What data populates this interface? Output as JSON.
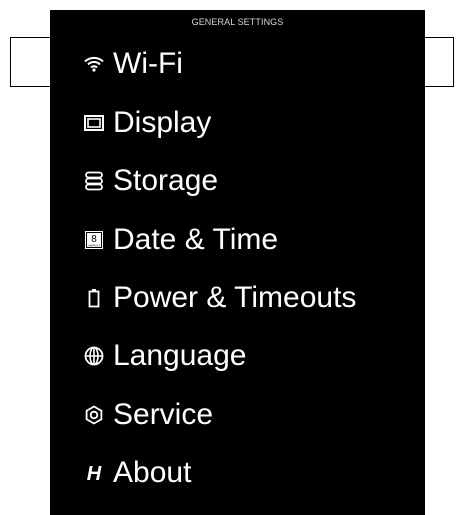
{
  "header": {
    "title": "GENERAL SETTINGS"
  },
  "menu": {
    "selected_index": 0,
    "items": [
      {
        "label": "Wi-Fi",
        "icon": "wifi-icon"
      },
      {
        "label": "Display",
        "icon": "display-icon"
      },
      {
        "label": "Storage",
        "icon": "storage-icon"
      },
      {
        "label": "Date & Time",
        "icon": "calendar-icon",
        "icon_text_big": "8",
        "icon_text_small": "MARCH"
      },
      {
        "label": "Power & Timeouts",
        "icon": "battery-icon"
      },
      {
        "label": "Language",
        "icon": "globe-icon"
      },
      {
        "label": "Service",
        "icon": "service-icon"
      },
      {
        "label": "About",
        "icon": "brand-logo-icon",
        "icon_text": "H"
      }
    ]
  },
  "colors": {
    "panel_background": "#000000",
    "text": "#ffffff",
    "header_text": "#d8d8d8",
    "selection_border": "#000000"
  }
}
